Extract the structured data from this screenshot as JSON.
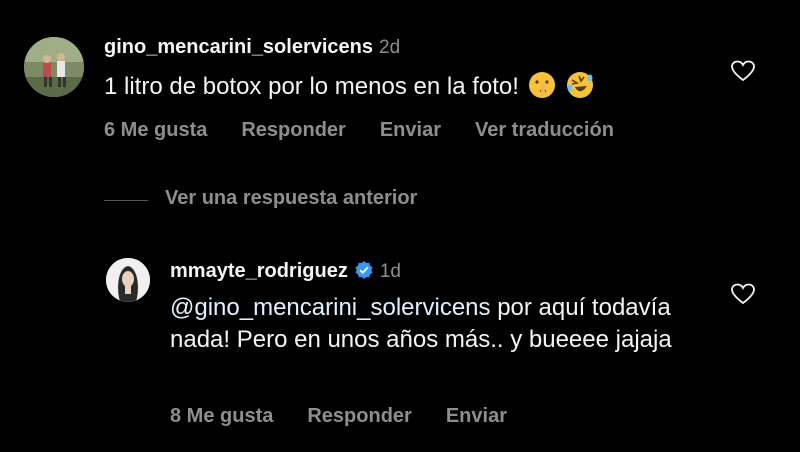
{
  "comment1": {
    "username": "gino_mencarini_solervicens",
    "time": "2d",
    "text": "1 litro de botox por lo menos en la foto!",
    "emojis": [
      "shushing-face-icon",
      "rolling-laughing-icon"
    ],
    "likes": "6 Me gusta",
    "reply": "Responder",
    "send": "Enviar",
    "translate": "Ver traducción"
  },
  "replies_toggle": {
    "label": "Ver una respuesta anterior"
  },
  "comment2": {
    "username": "mmayte_rodriguez",
    "time": "1d",
    "mention": "@gino_mencarini_solervicens",
    "text_after_mention": " por aquí todavía nada! Pero en unos años más.. y bueeee jajaja",
    "likes": "8 Me gusta",
    "reply": "Responder",
    "send": "Enviar"
  },
  "colors": {
    "background": "#000000",
    "text": "#f5f5f5",
    "muted": "#8e8e8e",
    "verified": "#3897f0"
  }
}
